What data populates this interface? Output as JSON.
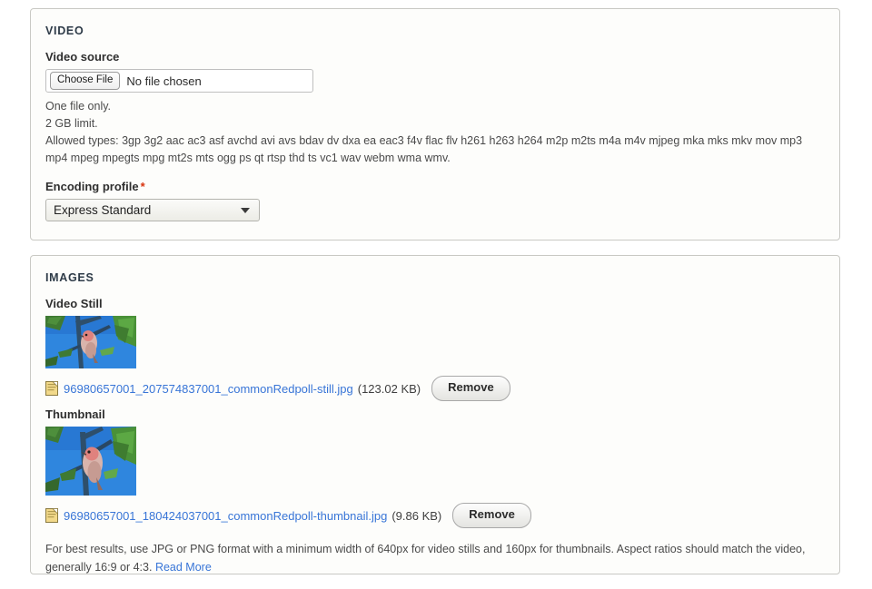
{
  "video_section": {
    "title": "VIDEO",
    "video_source": {
      "label": "Video source",
      "choose_file_label": "Choose File",
      "no_file_text": "No file chosen",
      "one_file_only": "One file only.",
      "size_limit": "2 GB limit.",
      "allowed_types": "Allowed types: 3gp 3g2 aac ac3 asf avchd avi avs bdav dv dxa ea eac3 f4v flac flv h261 h263 h264 m2p m2ts m4a m4v mjpeg mka mks mkv mov mp3 mp4 mpeg mpegts mpg mt2s mts ogg ps qt rtsp thd ts vc1 wav webm wma wmv."
    },
    "encoding_profile": {
      "label": "Encoding profile",
      "required_marker": "*",
      "selected": "Express Standard"
    }
  },
  "images_section": {
    "title": "IMAGES",
    "video_still": {
      "label": "Video Still",
      "file_icon": "document-icon",
      "filename": "96980657001_207574837001_commonRedpoll-still.jpg",
      "filesize": "(123.02 KB)",
      "remove_label": "Remove"
    },
    "thumbnail": {
      "label": "Thumbnail",
      "file_icon": "document-icon",
      "filename": "96980657001_180424037001_commonRedpoll-thumbnail.jpg",
      "filesize": "(9.86 KB)",
      "remove_label": "Remove"
    },
    "help_text": "For best results, use JPG or PNG format with a minimum width of 640px for video stills and 160px for thumbnails. Aspect ratios should match the video, generally 16:9 or 4:3.",
    "read_more_label": "Read More"
  },
  "colors": {
    "link": "#3875d7",
    "required": "#d8340f",
    "panel_bg": "#fdfdfb",
    "panel_border": "#c9c9c4",
    "heading": "#2e3b48"
  }
}
